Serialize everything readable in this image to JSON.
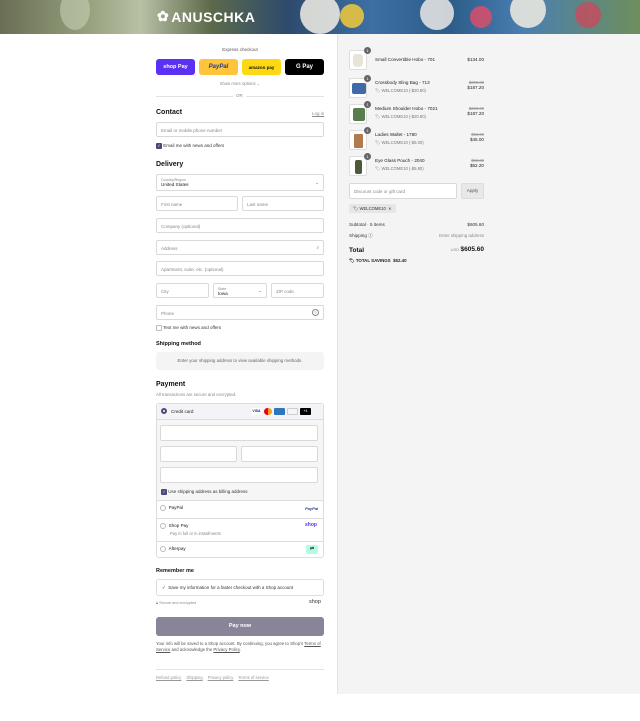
{
  "brand": {
    "name": "ANUSCHKA"
  },
  "express": {
    "title": "Express checkout",
    "shop_pay": "shop Pay",
    "paypal": "PayPal",
    "amazon": "amazon pay",
    "gpay": "G Pay",
    "show_more": "Show more options",
    "or": "OR"
  },
  "contact": {
    "title": "Contact",
    "login": "Log in",
    "email_placeholder": "Email or mobile phone number",
    "news_label": "Email me with news and offers"
  },
  "delivery": {
    "title": "Delivery",
    "country_label": "Country/Region",
    "country_value": "United States",
    "first_name": "First name",
    "last_name": "Last name",
    "company": "Company (optional)",
    "address": "Address",
    "apartment": "Apartment, suite, etc. (optional)",
    "city": "City",
    "state_label": "State",
    "state_value": "Iowa",
    "zip": "ZIP code",
    "phone": "Phone",
    "text_label": "Text me with news and offers"
  },
  "shipping_method": {
    "title": "Shipping method",
    "note": "Enter your shipping address to view available shipping methods."
  },
  "payment": {
    "title": "Payment",
    "subtitle": "All transactions are secure and encrypted.",
    "credit_card": "Credit card",
    "billing_label": "Use shipping address as billing address",
    "paypal": "PayPal",
    "shop_pay": "Shop Pay",
    "shop_pay_sub": "Pay in full or in installments",
    "afterpay": "Afterpay"
  },
  "remember": {
    "title": "Remember me",
    "save_label": "Save my information for a faster checkout with a Shop account",
    "secure": "Secure and encrypted",
    "shop_logo": "shop"
  },
  "pay_now": "Pay now",
  "legal": {
    "text_1": "Your info will be saved to a Shop account. By continuing, you agree to Shop's",
    "terms": "Terms of Service",
    "text_2": "and acknowledge the",
    "privacy": "Privacy Policy"
  },
  "footer": [
    "Refund policy",
    "Shipping",
    "Privacy policy",
    "Terms of service"
  ],
  "order": {
    "items": [
      {
        "qty": "1",
        "name": "Small Convertible Hobo - 701",
        "discount": "",
        "orig": "",
        "price": "$134.00"
      },
      {
        "qty": "1",
        "name": "Crossbody Sling Bag - 713",
        "discount": "WELCOME10 (-$20.80)",
        "orig": "$208.00",
        "price": "$187.20"
      },
      {
        "qty": "1",
        "name": "Medium Shoulder Hobo - 7021",
        "discount": "WELCOME10 (-$20.80)",
        "orig": "$208.00",
        "price": "$187.20"
      },
      {
        "qty": "1",
        "name": "Ladies Wallet - 1780",
        "discount": "WELCOME10 (-$5.00)",
        "orig": "$50.00",
        "price": "$45.00"
      },
      {
        "qty": "1",
        "name": "Eye Glass Pouch - 2040",
        "discount": "WELCOME10 (-$5.80)",
        "orig": "$58.00",
        "price": "$52.20"
      }
    ],
    "discount_placeholder": "Discount code or gift card",
    "apply": "Apply",
    "code_tag": "WELCOME10",
    "subtotal_label": "Subtotal · 5 items",
    "subtotal_value": "$605.60",
    "shipping_label": "Shipping",
    "shipping_value": "Enter shipping address",
    "total_label": "Total",
    "currency": "USD",
    "total_value": "$605.60",
    "savings_label": "TOTAL SAVINGS",
    "savings_value": "$52.40"
  }
}
